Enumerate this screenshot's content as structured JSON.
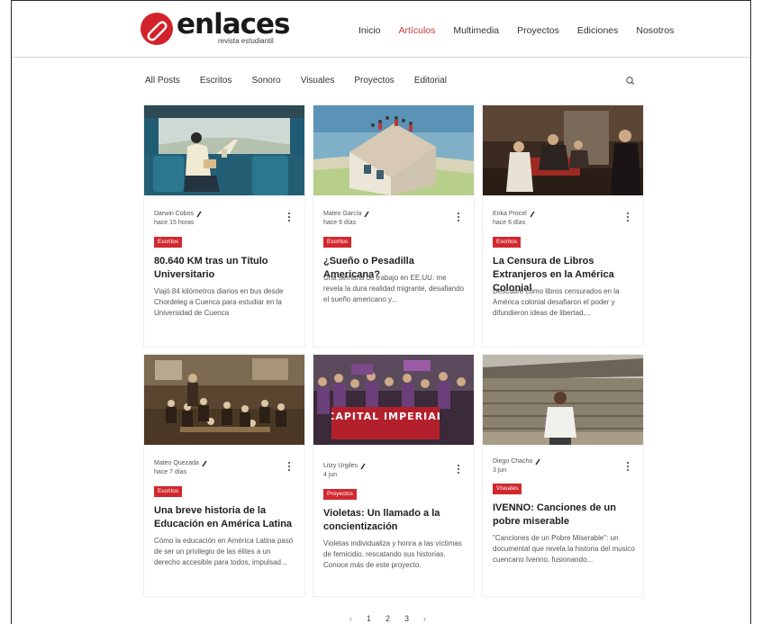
{
  "brand": {
    "name": "enlaces",
    "subtitle": "revista estudiantil",
    "accent": "#d2232a"
  },
  "nav": {
    "items": [
      "Inicio",
      "Artículos",
      "Multimedia",
      "Proyectos",
      "Ediciones",
      "Nosotros"
    ],
    "active": "Artículos"
  },
  "categories": [
    "All Posts",
    "Escritos",
    "Sonoro",
    "Visuales",
    "Proyectos",
    "Editorial"
  ],
  "search_icon": "search-icon",
  "posts": [
    {
      "author": "Darwin Cobos",
      "time": "hace 15 horas",
      "tag": "Escritos",
      "title": "80.640 KM tras un Título Universitario",
      "excerpt": "Viajó 84 kilómetros diarios en bus desde Chordeleg a Cuenca para estudiar en la Universidad de Cuenca"
    },
    {
      "author": "Mateo García",
      "time": "hace 6 días",
      "tag": "Escritos",
      "title": "¿Sueño o Pesadilla Americana?",
      "excerpt": "Una semana de trabajo en EE.UU. me revela la dura realidad migrante, desafiando el sueño americano y..."
    },
    {
      "author": "Erika Procel",
      "time": "hace 6 días",
      "tag": "Escritos",
      "title": "La Censura de Libros Extranjeros en la América Colonial",
      "excerpt": "Descubre cómo libros censurados en la América colonial desafiaron el poder y difundieron ideas de libertad,..."
    },
    {
      "author": "Mateo Quezada",
      "time": "hace 7 días",
      "tag": "Escritos",
      "title": "Una breve historia de la Educación en América Latina",
      "excerpt": "Cómo la educación en América Latina pasó de ser un privilegio de las élites a un derecho accesible para todos, impulsad..."
    },
    {
      "author": "Litzy Urgiles",
      "time": "4 jun",
      "tag": "Proyectos",
      "title": "Violetas: Un llamado a la concientización",
      "excerpt": "Violetas individualiza y honra a las víctimas de femicidio, rescatando sus historias. Conoce más de este proyecto.",
      "image_text": "CAPITAL IMPERIAL"
    },
    {
      "author": "Diego Chacho",
      "time": "3 jun",
      "tag": "Visuales",
      "title": "IVENNO: Canciones de un pobre miserable",
      "excerpt": "\"Canciones de un Pobre Miserable\": un documental que revela la historia del musico cuencano Ivenno, fusionando..."
    }
  ],
  "pagination": {
    "prev": "‹",
    "pages": [
      "1",
      "2",
      "3"
    ],
    "next": "›"
  }
}
